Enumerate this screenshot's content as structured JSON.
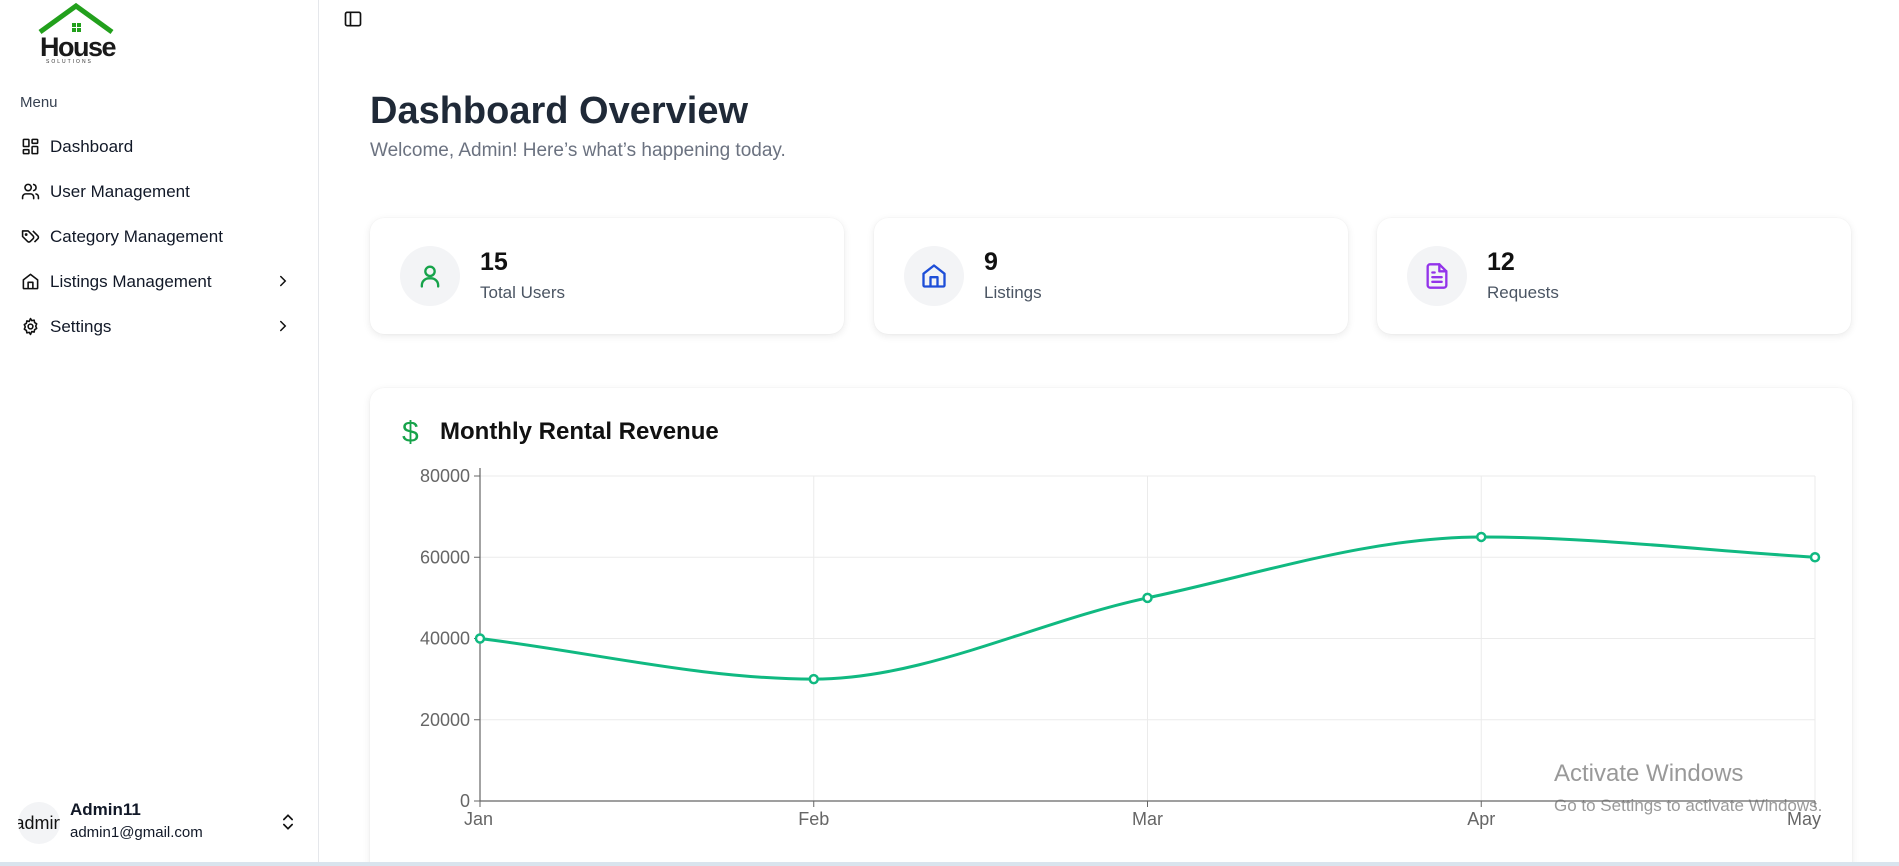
{
  "logo": {
    "text": "House",
    "subtext": "SOLUTIONS"
  },
  "sidebar": {
    "menu_heading": "Menu",
    "items": [
      {
        "label": "Dashboard",
        "icon": "dashboard-icon",
        "has_chevron": false
      },
      {
        "label": "User Management",
        "icon": "users-icon",
        "has_chevron": false
      },
      {
        "label": "Category Management",
        "icon": "tags-icon",
        "has_chevron": false
      },
      {
        "label": "Listings Management",
        "icon": "home-icon",
        "has_chevron": true
      },
      {
        "label": "Settings",
        "icon": "gear-icon",
        "has_chevron": true
      }
    ]
  },
  "user": {
    "avatar_text": "admin",
    "name": "Admin11",
    "email": "admin1@gmail.com"
  },
  "header": {
    "title": "Dashboard Overview",
    "subtitle": "Welcome, Admin! Here’s what’s happening today."
  },
  "stats": [
    {
      "value": "15",
      "label": "Total Users",
      "icon": "user-icon",
      "color": "#16a34a"
    },
    {
      "value": "9",
      "label": "Listings",
      "icon": "home-icon",
      "color": "#1d4ed8"
    },
    {
      "value": "12",
      "label": "Requests",
      "icon": "document-icon",
      "color": "#9333ea"
    }
  ],
  "chart_card": {
    "title": "Monthly Rental Revenue",
    "icon": "dollar-icon",
    "icon_glyph": "$"
  },
  "chart_data": {
    "type": "line",
    "title": "Monthly Rental Revenue",
    "categories": [
      "Jan",
      "Feb",
      "Mar",
      "Apr",
      "May"
    ],
    "series": [
      {
        "values": [
          40000,
          30000,
          50000,
          65000,
          60000
        ],
        "color": "#10b981"
      }
    ],
    "ylim": [
      0,
      80000
    ],
    "yticks": [
      0,
      20000,
      40000,
      60000,
      80000
    ],
    "grid": true
  },
  "watermark": {
    "title": "Activate Windows",
    "subtitle": "Go to Settings to activate Windows."
  }
}
